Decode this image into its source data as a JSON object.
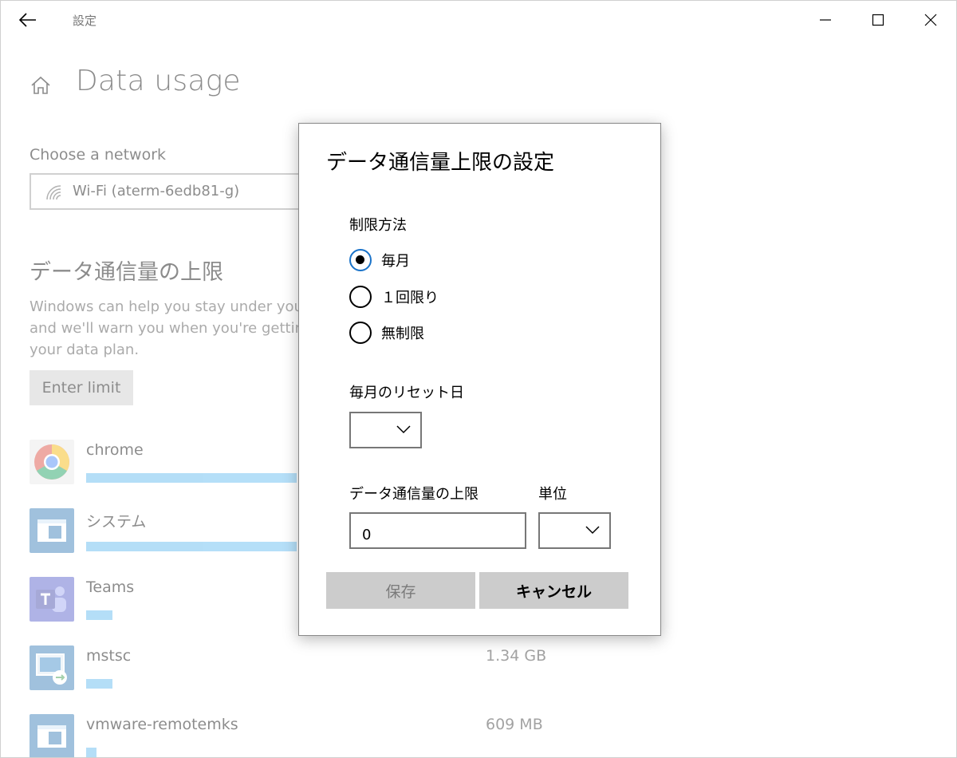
{
  "window": {
    "title": "設定"
  },
  "page": {
    "title": "Data usage",
    "choose_network_label": "Choose a network",
    "network_value": "Wi-Fi (aterm-6edb81-g)",
    "limit_heading": "データ通信量の上限",
    "limit_description": [
      "Windows can help you stay under you",
      "and we'll warn you when you're getting",
      "your data plan."
    ],
    "enter_limit_label": "Enter limit",
    "apps": [
      {
        "name": "chrome",
        "usage": "",
        "bar_fraction": 0.24,
        "icon": "chrome-icon"
      },
      {
        "name": "システム",
        "usage": "",
        "bar_fraction": 0.24,
        "icon": "system-icon"
      },
      {
        "name": "Teams",
        "usage": "",
        "bar_fraction": 0.03,
        "icon": "teams-icon"
      },
      {
        "name": "mstsc",
        "usage": "1.34 GB",
        "bar_fraction": 0.03,
        "icon": "remote-desktop-icon"
      },
      {
        "name": "vmware-remotemks",
        "usage": "609 MB",
        "bar_fraction": 0.012,
        "icon": "vmware-icon"
      }
    ]
  },
  "dialog": {
    "title": "データ通信量上限の設定",
    "method_label": "制限方法",
    "options": [
      {
        "label": "毎月",
        "checked": true
      },
      {
        "label": "１回限り",
        "checked": false
      },
      {
        "label": "無制限",
        "checked": false
      }
    ],
    "reset_day_label": "毎月のリセット日",
    "reset_day_value": "",
    "limit_label": "データ通信量の上限",
    "limit_value": "0",
    "unit_label": "単位",
    "unit_value": "",
    "save_label": "保存",
    "cancel_label": "キャンセル"
  }
}
